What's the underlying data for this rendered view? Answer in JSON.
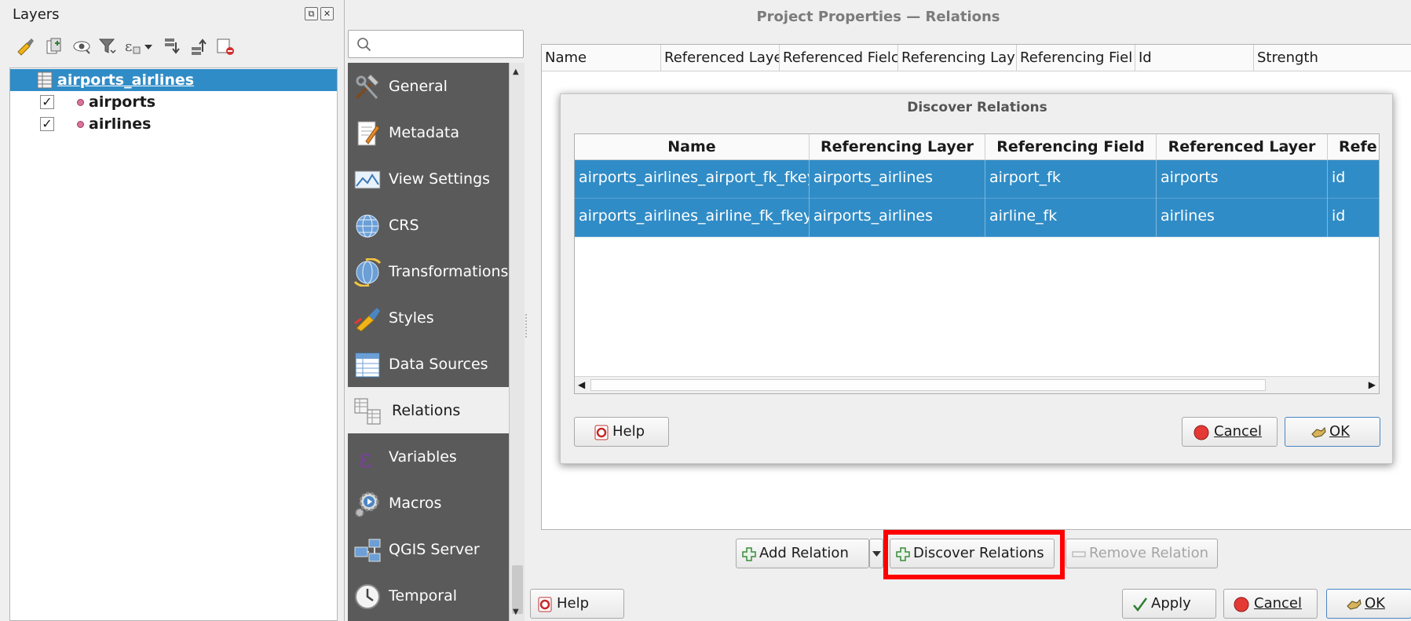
{
  "layers_panel": {
    "title": "Layers",
    "dock_buttons": [
      "restore-icon",
      "close-icon"
    ],
    "toolbar_icons": [
      "style-manager-icon",
      "add-group-icon",
      "visibility-icon",
      "filter-legend-icon",
      "filter-expression-icon",
      "dropdown-arrow-icon",
      "expand-all-icon",
      "collapse-all-icon",
      "remove-layer-icon"
    ],
    "layers": [
      {
        "name": "airports_airlines",
        "type": "table",
        "selected": true
      },
      {
        "name": "airports",
        "type": "point",
        "checked": true
      },
      {
        "name": "airlines",
        "type": "point",
        "checked": true
      }
    ]
  },
  "project_properties": {
    "title": "Project Properties — Relations",
    "search": {
      "value": "",
      "placeholder": ""
    },
    "nav_items": [
      {
        "label": "General",
        "icon": "hammer-wrench-icon"
      },
      {
        "label": "Metadata",
        "icon": "metadata-icon"
      },
      {
        "label": "View Settings",
        "icon": "view-settings-icon"
      },
      {
        "label": "CRS",
        "icon": "globe-icon"
      },
      {
        "label": "Transformations",
        "icon": "transform-globe-icon"
      },
      {
        "label": "Styles",
        "icon": "paintbrush-icon"
      },
      {
        "label": "Data Sources",
        "icon": "data-sources-icon"
      },
      {
        "label": "Relations",
        "icon": "relations-icon",
        "active": true
      },
      {
        "label": "Variables",
        "icon": "epsilon-icon"
      },
      {
        "label": "Macros",
        "icon": "gear-play-icon"
      },
      {
        "label": "QGIS Server",
        "icon": "server-icon"
      },
      {
        "label": "Temporal",
        "icon": "clock-icon"
      }
    ],
    "relations_columns": [
      "Name",
      "Referenced Laye",
      "Referenced Fielc",
      "Referencing Lay",
      "Referencing Fiel",
      "Id",
      "Strength"
    ],
    "buttons": {
      "add_relation": "Add Relation",
      "discover_relations": "Discover Relations",
      "remove_relation": "Remove Relation",
      "help": "Help",
      "apply": "Apply",
      "cancel": "Cancel",
      "ok": "OK"
    }
  },
  "discover_dialog": {
    "title": "Discover Relations",
    "columns": [
      "Name",
      "Referencing Layer",
      "Referencing Field",
      "Referenced Layer",
      "Refe"
    ],
    "rows": [
      [
        "airports_airlines_airport_fk_fkey",
        "airports_airlines",
        "airport_fk",
        "airports",
        "id"
      ],
      [
        "airports_airlines_airline_fk_fkey",
        "airports_airlines",
        "airline_fk",
        "airlines",
        "id"
      ]
    ],
    "buttons": {
      "help": "Help",
      "cancel": "Cancel",
      "ok": "OK"
    }
  },
  "colors": {
    "selection": "#308cc6",
    "nav_background": "#5a5a5a",
    "highlight": "#ff0000"
  }
}
